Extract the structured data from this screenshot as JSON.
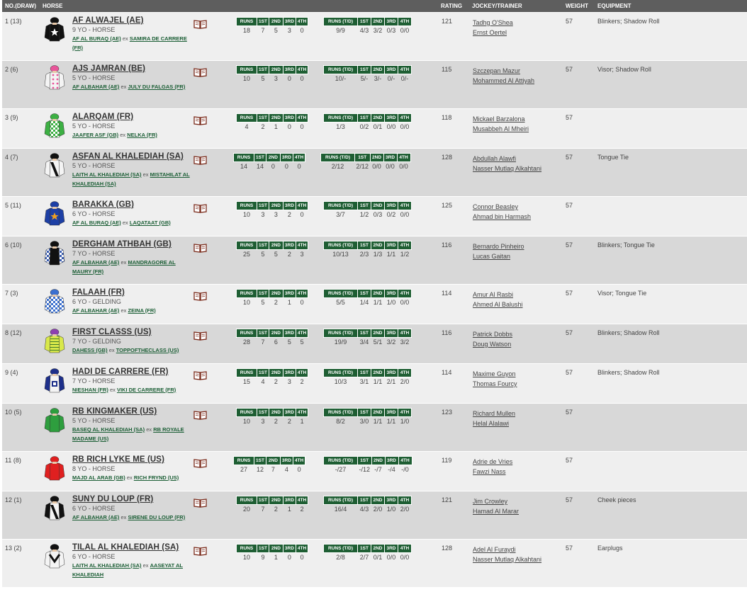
{
  "header": {
    "no_draw": "NO.(DRAW)",
    "horse": "HORSE",
    "rating": "RATING",
    "jockey_trainer": "JOCKEY/TRAINER",
    "weight": "WEIGHT",
    "equipment": "EQUIPMENT"
  },
  "stat_headers": {
    "runs": "RUNS",
    "runs_td": "RUNS (T/D)",
    "first": "1ST",
    "second": "2ND",
    "third": "3RD",
    "fourth": "4TH"
  },
  "rows": [
    {
      "no": "1 (13)",
      "name": "AF ALWAJEL (AE)",
      "age": "9 YO - HORSE",
      "sire": "AF AL BURAQ (AE)",
      "ex": "ex",
      "dam": "SAMIRA DE CARRERE (FR)",
      "runs": [
        "18",
        "7",
        "5",
        "3",
        "0"
      ],
      "td": [
        "9/9",
        "4/3",
        "3/2",
        "0/3",
        "0/0"
      ],
      "rating": "121",
      "jockey": "Tadhg O'Shea",
      "trainer": "Ernst Oertel",
      "weight": "57",
      "equipment": "Blinkers; Shadow Roll",
      "silk": {
        "body": "#111111",
        "sleeve": "#111111",
        "cap": "#111111",
        "mark": "star-white"
      }
    },
    {
      "no": "2 (6)",
      "name": "AJS JAMRAN (BE)",
      "age": "5 YO - HORSE",
      "sire": "AF ALBAHAR (AE)",
      "ex": "ex",
      "dam": "JULY DU FALGAS (FR)",
      "runs": [
        "10",
        "5",
        "3",
        "0",
        "0"
      ],
      "td": [
        "10/-",
        "5/-",
        "3/-",
        "0/-",
        "0/-"
      ],
      "rating": "115",
      "jockey": "Szczepan Mazur",
      "trainer": "Mohammed Al Attiyah",
      "weight": "57",
      "equipment": "Visor; Shadow Roll",
      "silk": {
        "body": "#f4f4f4",
        "sleeve": "#f4f4f4",
        "cap": "#e8559a",
        "mark": "pink-spots"
      }
    },
    {
      "no": "3 (9)",
      "name": "ALARQAM (FR)",
      "age": "5 YO - HORSE",
      "sire": "JAAFER ASF (GB)",
      "ex": "ex",
      "dam": "NELKA (FR)",
      "runs": [
        "4",
        "2",
        "1",
        "0",
        "0"
      ],
      "td": [
        "1/3",
        "0/2",
        "0/1",
        "0/0",
        "0/0"
      ],
      "rating": "118",
      "jockey": "Mickael Barzalona",
      "trainer": "Musabbeh Al Mheiri",
      "weight": "57",
      "equipment": "",
      "silk": {
        "body": "#3cb043",
        "sleeve": "#3cb043",
        "cap": "#3cb043",
        "mark": "green-check"
      }
    },
    {
      "no": "4 (7)",
      "name": "ASFAN AL KHALEDIAH (SA)",
      "age": "5 YO - HORSE",
      "sire": "LAITH AL KHALEDIAH (SA)",
      "ex": "ex",
      "dam": "MISTAHILAT AL KHALEDIAH (SA)",
      "runs": [
        "14",
        "14",
        "0",
        "0",
        "0"
      ],
      "td": [
        "2/12",
        "2/12",
        "0/0",
        "0/0",
        "0/0"
      ],
      "rating": "128",
      "jockey": "Abdullah Alawfi",
      "trainer": "Nasser Mutlaq Alkahtani",
      "weight": "57",
      "equipment": "Tongue Tie",
      "silk": {
        "body": "#f4f4f4",
        "sleeve": "#f4f4f4",
        "cap": "#111111",
        "mark": "black-sash"
      }
    },
    {
      "no": "5 (11)",
      "name": "BARAKKA (GB)",
      "age": "6 YO - HORSE",
      "sire": "AF AL BURAQ (AE)",
      "ex": "ex",
      "dam": "LAQATAAT (GB)",
      "runs": [
        "10",
        "3",
        "3",
        "2",
        "0"
      ],
      "td": [
        "3/7",
        "1/2",
        "0/3",
        "0/2",
        "0/0"
      ],
      "rating": "125",
      "jockey": "Connor Beasley",
      "trainer": "Ahmad bin Harmash",
      "weight": "57",
      "equipment": "",
      "silk": {
        "body": "#1d3fa5",
        "sleeve": "#1d3fa5",
        "cap": "#1d3fa5",
        "mark": "star-orange"
      }
    },
    {
      "no": "6 (10)",
      "name": "DERGHAM ATHBAH (GB)",
      "age": "7 YO - HORSE",
      "sire": "AF ALBAHAR (AE)",
      "ex": "ex",
      "dam": "MANDRAGORE AL MAURY (FR)",
      "runs": [
        "25",
        "5",
        "5",
        "2",
        "3"
      ],
      "td": [
        "10/13",
        "2/3",
        "1/3",
        "1/1",
        "1/2"
      ],
      "rating": "116",
      "jockey": "Bernardo Pinheiro",
      "trainer": "Lucas Gaitan",
      "weight": "57",
      "equipment": "Blinkers; Tongue Tie",
      "silk": {
        "body": "#111111",
        "sleeve": "#3a5db0",
        "cap": "#111111",
        "mark": "blue-check"
      }
    },
    {
      "no": "7 (3)",
      "name": "FALAAH (FR)",
      "age": "6 YO - GELDING",
      "sire": "AF ALBAHAR (AE)",
      "ex": "ex",
      "dam": "ZEINA (FR)",
      "runs": [
        "10",
        "5",
        "2",
        "1",
        "0"
      ],
      "td": [
        "5/5",
        "1/4",
        "1/1",
        "1/0",
        "0/0"
      ],
      "rating": "114",
      "jockey": "Amur Al Rasbi",
      "trainer": "Ahmed Al Balushi",
      "weight": "57",
      "equipment": "Visor; Tongue Tie",
      "silk": {
        "body": "#3a6fd0",
        "sleeve": "#3a6fd0",
        "cap": "#3a6fd0",
        "mark": "blue-check"
      }
    },
    {
      "no": "8 (12)",
      "name": "FIRST CLASSS (US)",
      "age": "7 YO - GELDING",
      "sire": "DAHESS (GB)",
      "ex": "ex",
      "dam": "TOPPOFTHECLASS (US)",
      "runs": [
        "28",
        "7",
        "6",
        "5",
        "5"
      ],
      "td": [
        "19/9",
        "3/4",
        "5/1",
        "3/2",
        "3/2"
      ],
      "rating": "116",
      "jockey": "Patrick Dobbs",
      "trainer": "Doug Watson",
      "weight": "57",
      "equipment": "Blinkers; Shadow Roll",
      "silk": {
        "body": "#d9e84a",
        "sleeve": "#d9e84a",
        "cap": "#8c3fb0",
        "mark": "hoops"
      }
    },
    {
      "no": "9 (4)",
      "name": "HADI DE CARRERE (FR)",
      "age": "7 YO - HORSE",
      "sire": "NIESHAN (FR)",
      "ex": "ex",
      "dam": "VIKI DE CARRERE (FR)",
      "runs": [
        "15",
        "4",
        "2",
        "3",
        "2"
      ],
      "td": [
        "10/3",
        "3/1",
        "1/1",
        "2/1",
        "2/0"
      ],
      "rating": "114",
      "jockey": "Maxime Guyon",
      "trainer": "Thomas Fourcy",
      "weight": "57",
      "equipment": "Blinkers; Shadow Roll",
      "silk": {
        "body": "#f4f4f4",
        "sleeve": "#1d2f8a",
        "cap": "#1d2f8a",
        "mark": "blue-diamond"
      }
    },
    {
      "no": "10 (5)",
      "name": "RB KINGMAKER (US)",
      "age": "5 YO - HORSE",
      "sire": "BASEQ AL KHALEDIAH (SA)",
      "ex": "ex",
      "dam": "RB ROYALE MADAME (US)",
      "runs": [
        "10",
        "3",
        "2",
        "2",
        "1"
      ],
      "td": [
        "8/2",
        "3/0",
        "1/1",
        "1/1",
        "1/0"
      ],
      "rating": "123",
      "jockey": "Richard Mullen",
      "trainer": "Helal Alalawi",
      "weight": "57",
      "equipment": "",
      "silk": {
        "body": "#2e9e3e",
        "sleeve": "#2e9e3e",
        "cap": "#2e9e3e",
        "mark": "plain"
      }
    },
    {
      "no": "11 (8)",
      "name": "RB RICH LYKE ME (US)",
      "age": "8 YO - HORSE",
      "sire": "MAJD AL ARAB (GB)",
      "ex": "ex",
      "dam": "RICH FRYND (US)",
      "runs": [
        "27",
        "12",
        "7",
        "4",
        "0"
      ],
      "td": [
        "-/27",
        "-/12",
        "-/7",
        "-/4",
        "-/0"
      ],
      "rating": "119",
      "jockey": "Adrie de Vries",
      "trainer": "Fawzi Nass",
      "weight": "57",
      "equipment": "",
      "silk": {
        "body": "#e02020",
        "sleeve": "#e02020",
        "cap": "#e02020",
        "mark": "plain"
      }
    },
    {
      "no": "12 (1)",
      "name": "SUNY DU LOUP (FR)",
      "age": "6 YO - HORSE",
      "sire": "AF ALBAHAR (AE)",
      "ex": "ex",
      "dam": "SIRENE DU LOUP (FR)",
      "runs": [
        "20",
        "7",
        "2",
        "1",
        "2"
      ],
      "td": [
        "16/4",
        "4/3",
        "2/0",
        "1/0",
        "2/0"
      ],
      "rating": "121",
      "jockey": "Jim Crowley",
      "trainer": "Hamad Al Marar",
      "weight": "57",
      "equipment": "Cheek pieces",
      "silk": {
        "body": "#f4f4f4",
        "sleeve": "#111111",
        "cap": "#111111",
        "mark": "black-sash"
      }
    },
    {
      "no": "13 (2)",
      "name": "TILAL AL KHALEDIAH (SA)",
      "age": "6 YO - HORSE",
      "sire": "LAITH AL KHALEDIAH (SA)",
      "ex": "ex",
      "dam": "AASEYAT AL KHALEDIAH",
      "runs": [
        "10",
        "9",
        "1",
        "0",
        "0"
      ],
      "td": [
        "2/8",
        "2/7",
        "0/1",
        "0/0",
        "0/0"
      ],
      "rating": "128",
      "jockey": "Adel Al Furaydi",
      "trainer": "Nasser Mutlaq Alkahtani",
      "weight": "57",
      "equipment": "Earplugs",
      "silk": {
        "body": "#f4f4f4",
        "sleeve": "#f4f4f4",
        "cap": "#111111",
        "mark": "black-chevron"
      }
    }
  ]
}
